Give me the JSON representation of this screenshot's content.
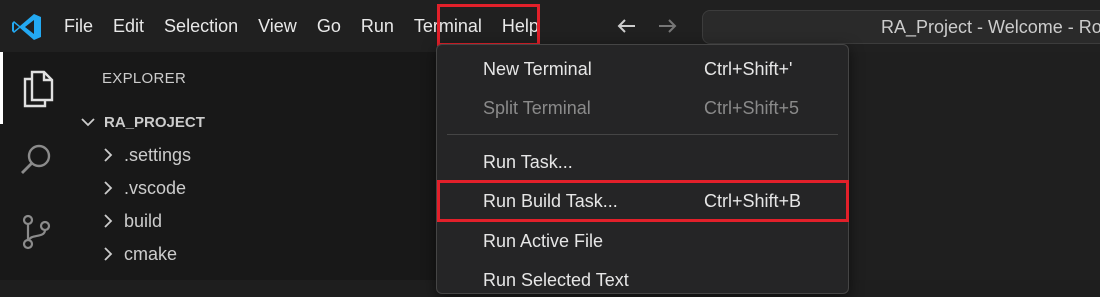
{
  "menubar": {
    "items": [
      "File",
      "Edit",
      "Selection",
      "View",
      "Go",
      "Run",
      "Terminal",
      "Help"
    ]
  },
  "search": {
    "text": "RA_Project - Welcome - Rochester Astro"
  },
  "colors": {
    "highlight": "#e2202a",
    "accent": "#007acc"
  },
  "icons": {
    "logo": "vscode-logo-icon",
    "explorer": "files-icon",
    "search": "search-icon",
    "scm": "source-control-icon"
  },
  "sidebar": {
    "title": "EXPLORER",
    "root": "RA_PROJECT",
    "items": [
      ".settings",
      ".vscode",
      "build",
      "cmake"
    ]
  },
  "terminal_menu": {
    "items": [
      {
        "label": "New Terminal",
        "shortcut": "Ctrl+Shift+'"
      },
      {
        "label": "Split Terminal",
        "shortcut": "Ctrl+Shift+5"
      },
      {
        "label": "Run Task...",
        "shortcut": ""
      },
      {
        "label": "Run Build Task...",
        "shortcut": "Ctrl+Shift+B"
      },
      {
        "label": "Run Active File",
        "shortcut": ""
      },
      {
        "label": "Run Selected Text",
        "shortcut": ""
      }
    ]
  }
}
